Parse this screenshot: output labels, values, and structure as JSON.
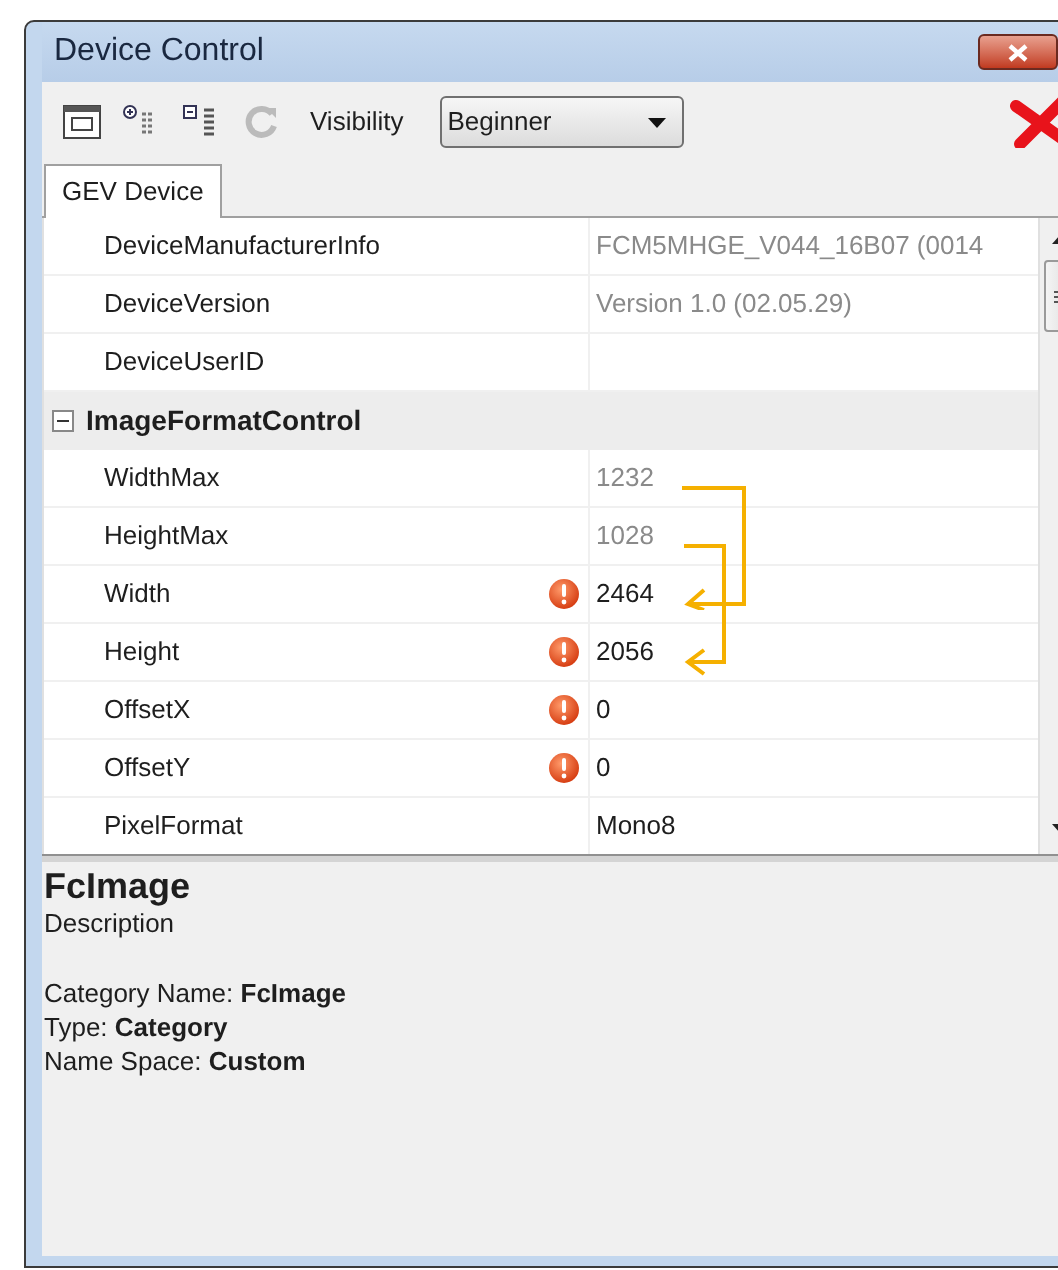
{
  "window": {
    "title": "Device Control"
  },
  "toolbar": {
    "visibility_label": "Visibility",
    "visibility_value": "Beginner"
  },
  "tabs": [
    {
      "label": "GEV Device",
      "selected": true
    }
  ],
  "grid": {
    "rows": [
      {
        "kind": "property",
        "name": "DeviceManufacturerInfo",
        "value": "FCM5MHGE_V044_16B07  (0014",
        "readonly": true,
        "warning": false
      },
      {
        "kind": "property",
        "name": "DeviceVersion",
        "value": "Version 1.0  (02.05.29)",
        "readonly": true,
        "warning": false
      },
      {
        "kind": "property",
        "name": "DeviceUserID",
        "warning": false
      },
      {
        "kind": "category",
        "name": "ImageFormatControl",
        "expanded": true
      },
      {
        "kind": "property",
        "name": "WidthMax",
        "value": "1232",
        "readonly": true,
        "warning": false
      },
      {
        "kind": "property",
        "name": "HeightMax",
        "value": "1028",
        "readonly": true,
        "warning": false
      },
      {
        "kind": "property",
        "name": "Width",
        "value": "2464",
        "readonly": false,
        "warning": true
      },
      {
        "kind": "property",
        "name": "Height",
        "value": "2056",
        "readonly": false,
        "warning": true
      },
      {
        "kind": "property",
        "name": "OffsetX",
        "value": "0",
        "readonly": false,
        "warning": true
      },
      {
        "kind": "property",
        "name": "OffsetY",
        "value": "0",
        "readonly": false,
        "warning": true
      },
      {
        "kind": "property",
        "name": "PixelFormat",
        "value": "Mono8",
        "readonly": false,
        "warning": false
      }
    ]
  },
  "description": {
    "title": "FcImage",
    "subtitle": "Description",
    "lines": [
      "Category Name: **FcImage**",
      "Type: **Category**",
      "Name Space: **Custom**"
    ]
  }
}
